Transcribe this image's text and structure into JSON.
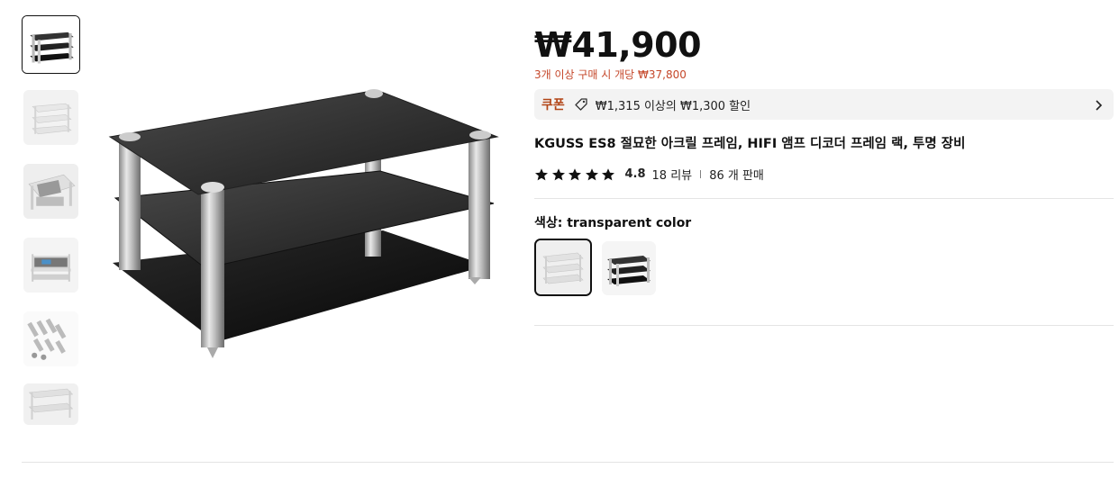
{
  "gallery": {
    "thumbnails": [
      {
        "name": "thumbnail-black-rack",
        "active": true
      },
      {
        "name": "thumbnail-clear-rack",
        "active": false
      },
      {
        "name": "thumbnail-device-top",
        "active": false
      },
      {
        "name": "thumbnail-device-front",
        "active": false
      },
      {
        "name": "thumbnail-pillars-parts",
        "active": false
      },
      {
        "name": "thumbnail-clear-rack-2",
        "active": false
      }
    ]
  },
  "product": {
    "price": "₩41,900",
    "bulk_discount": "3개 이상 구매 시 개당 ₩37,800",
    "coupon": {
      "label": "쿠폰",
      "text": "₩1,315 이상의 ₩1,300 할인"
    },
    "title": "KGUSS ES8 절묘한 아크릴 프레임, HIFI 앰프 디코더 프레임 랙, 투명 장비",
    "rating": {
      "stars": 5,
      "score": "4.8",
      "reviews": "18 리뷰",
      "separator": "|",
      "sold": "86 개 판매"
    },
    "color": {
      "label": "색상: transparent color",
      "options": [
        "transparent color",
        "black"
      ]
    }
  },
  "colors": {
    "accent": "#b24517",
    "bulk_text": "#c5472a",
    "coupon_bg": "#f3f3f3"
  }
}
